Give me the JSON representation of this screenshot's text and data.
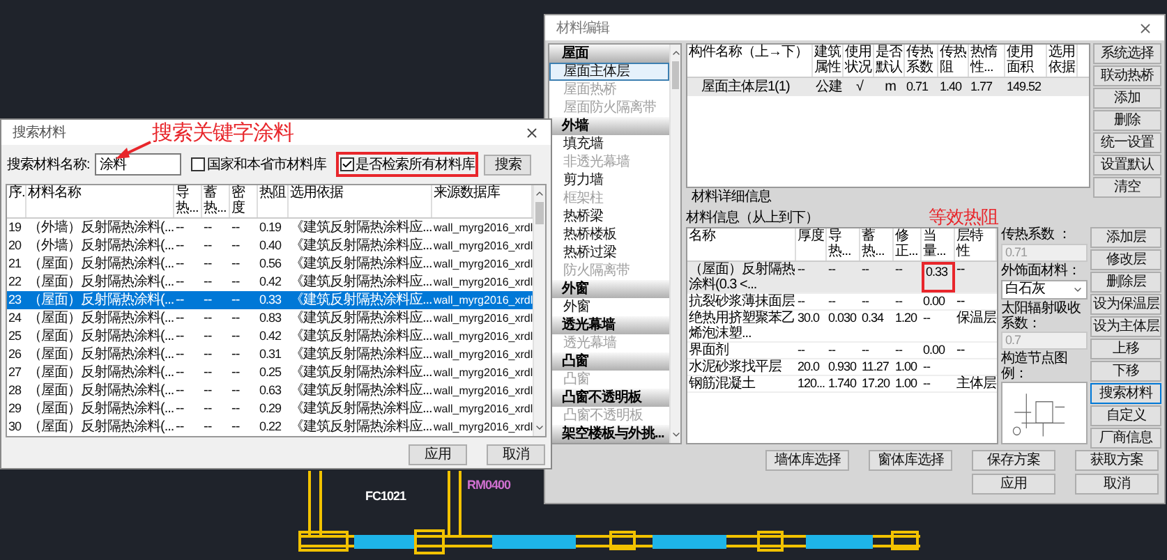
{
  "search_dialog": {
    "title": "搜索材料",
    "annotation": "搜索关键字涂料",
    "search_label": "搜索材料名称:",
    "search_value": "涂料",
    "options": [
      {
        "label": "国家和本省市材料库",
        "checked": false,
        "marked": false
      },
      {
        "label": "是否检索所有材料库",
        "checked": true,
        "marked": true
      }
    ],
    "search_button": "搜索",
    "columns": [
      "序.",
      "材料名称",
      "导热...",
      "蓄热...",
      "密度",
      "热阻",
      "选用依据",
      "来源数据库"
    ],
    "rows": [
      {
        "cells": [
          "19",
          "（外墙）反射隔热涂料(...",
          "--",
          "--",
          "--",
          "0.19",
          "《建筑反射隔热涂料应...",
          "wall_myrg2016_xrdl"
        ],
        "selected": false
      },
      {
        "cells": [
          "20",
          "（外墙）反射隔热涂料(...",
          "--",
          "--",
          "--",
          "0.40",
          "《建筑反射隔热涂料应...",
          "wall_myrg2016_xrdl"
        ],
        "selected": false
      },
      {
        "cells": [
          "21",
          "（屋面）反射隔热涂料(...",
          "--",
          "--",
          "--",
          "0.56",
          "《建筑反射隔热涂料应...",
          "wall_myrg2016_xrdl"
        ],
        "selected": false
      },
      {
        "cells": [
          "22",
          "（屋面）反射隔热涂料(...",
          "--",
          "--",
          "--",
          "0.42",
          "《建筑反射隔热涂料应...",
          "wall_myrg2016_xrdl"
        ],
        "selected": false
      },
      {
        "cells": [
          "23",
          "（屋面）反射隔热涂料(...",
          "--",
          "--",
          "--",
          "0.33",
          "《建筑反射隔热涂料应...",
          "wall_myrg2016_xrdl"
        ],
        "selected": true
      },
      {
        "cells": [
          "24",
          "（屋面）反射隔热涂料(...",
          "--",
          "--",
          "--",
          "0.83",
          "《建筑反射隔热涂料应...",
          "wall_myrg2016_xrdl"
        ],
        "selected": false
      },
      {
        "cells": [
          "25",
          "（屋面）反射隔热涂料(...",
          "--",
          "--",
          "--",
          "0.42",
          "《建筑反射隔热涂料应...",
          "wall_myrg2016_xrdl"
        ],
        "selected": false
      },
      {
        "cells": [
          "26",
          "（屋面）反射隔热涂料(...",
          "--",
          "--",
          "--",
          "0.31",
          "《建筑反射隔热涂料应...",
          "wall_myrg2016_xrdl"
        ],
        "selected": false
      },
      {
        "cells": [
          "27",
          "（屋面）反射隔热涂料(...",
          "--",
          "--",
          "--",
          "0.25",
          "《建筑反射隔热涂料应...",
          "wall_myrg2016_xrdl"
        ],
        "selected": false
      },
      {
        "cells": [
          "28",
          "（屋面）反射隔热涂料(...",
          "--",
          "--",
          "--",
          "0.63",
          "《建筑反射隔热涂料应...",
          "wall_myrg2016_xrdl"
        ],
        "selected": false
      },
      {
        "cells": [
          "29",
          "（屋面）反射隔热涂料(...",
          "--",
          "--",
          "--",
          "0.29",
          "《建筑反射隔热涂料应...",
          "wall_myrg2016_xrdl"
        ],
        "selected": false
      },
      {
        "cells": [
          "30",
          "（屋面）反射隔热涂料(...",
          "--",
          "--",
          "--",
          "0.22",
          "《建筑反射隔热涂料应...",
          "wall_myrg2016_xrdl"
        ],
        "selected": false
      }
    ],
    "buttons": [
      "应用",
      "取消"
    ]
  },
  "editor_dialog": {
    "title": "材料编辑",
    "sidebar": [
      {
        "title": "屋面",
        "items": [
          {
            "label": "屋面主体层",
            "selected": true,
            "disabled": false
          },
          {
            "label": "屋面热桥",
            "selected": false,
            "disabled": true
          },
          {
            "label": "屋面防火隔离带",
            "selected": false,
            "disabled": true
          }
        ]
      },
      {
        "title": "外墙",
        "items": [
          {
            "label": "填充墙",
            "selected": false,
            "disabled": false
          },
          {
            "label": "非透光幕墙",
            "selected": false,
            "disabled": true
          },
          {
            "label": "剪力墙",
            "selected": false,
            "disabled": false
          },
          {
            "label": "框架柱",
            "selected": false,
            "disabled": true
          },
          {
            "label": "热桥梁",
            "selected": false,
            "disabled": false
          },
          {
            "label": "热桥楼板",
            "selected": false,
            "disabled": false
          },
          {
            "label": "热桥过梁",
            "selected": false,
            "disabled": false
          },
          {
            "label": "防火隔离带",
            "selected": false,
            "disabled": true
          }
        ]
      },
      {
        "title": "外窗",
        "items": [
          {
            "label": "外窗",
            "selected": false,
            "disabled": false
          }
        ]
      },
      {
        "title": "透光幕墙",
        "items": [
          {
            "label": "透光幕墙",
            "selected": false,
            "disabled": true
          }
        ]
      },
      {
        "title": "凸窗",
        "items": [
          {
            "label": "凸窗",
            "selected": false,
            "disabled": true
          }
        ]
      },
      {
        "title": "凸窗不透明板",
        "items": [
          {
            "label": "凸窗不透明板",
            "selected": false,
            "disabled": true
          }
        ]
      },
      {
        "title": "架空楼板与外挑..."
      }
    ],
    "layers_table": {
      "columns": [
        "构件名称（上→下）",
        "建筑属性",
        "使用状况",
        "是否默认",
        "传热系数",
        "传热阻",
        "热惰性...",
        "使用面积",
        "选用依据"
      ],
      "rows": [
        {
          "cells": [
            "屋面主体层1(1)",
            "公建",
            "√",
            "m",
            "0.71",
            "1.40",
            "1.77",
            "149.52"
          ],
          "selected": true
        }
      ]
    },
    "side_buttons": [
      "系统选择",
      "联动热桥",
      "添加",
      "删除",
      "统一设置",
      "设置默认",
      "清空"
    ],
    "details_title": "材料详细信息",
    "material_info_label": "材料信息（从上到下）",
    "annotation": "等效热阻",
    "material_table": {
      "columns": [
        "名称",
        "厚度",
        "导热...",
        "蓄热...",
        "修正...",
        "当量...",
        "层特性"
      ],
      "rows": [
        {
          "cells": [
            "（屋面）反射隔热涂料(0.3 <...",
            "--",
            "--",
            "--",
            "--",
            "0.33",
            "--"
          ],
          "selected": true,
          "marked": true
        },
        {
          "cells": [
            "抗裂砂浆薄抹面层",
            "--",
            "--",
            "--",
            "--",
            "0.00",
            "--"
          ],
          "selected": false,
          "marked": false
        },
        {
          "cells": [
            "绝热用挤塑聚苯乙烯泡沫塑...",
            "30.0",
            "0.030",
            "0.34",
            "1.20",
            "--",
            "保温层"
          ],
          "selected": false,
          "marked": false
        },
        {
          "cells": [
            "界面剂",
            "--",
            "--",
            "--",
            "--",
            "0.00",
            "--"
          ],
          "selected": false,
          "marked": false
        },
        {
          "cells": [
            "水泥砂浆找平层",
            "20.0",
            "0.930",
            "11.27",
            "1.00",
            "--"
          ],
          "selected": false,
          "marked": false
        },
        {
          "cells": [
            "钢筋混凝土",
            "120...",
            "1.740",
            "17.20",
            "1.00",
            "--",
            "主体层"
          ],
          "selected": false,
          "marked": false
        }
      ]
    },
    "properties": {
      "conductivity_label": "传热系数 ：",
      "conductivity_value": "0.71",
      "finish_label": "外饰面材料：",
      "finish_value": "白石灰",
      "absorption_label": "太阳辐射吸收系数：",
      "absorption_value": "0.7",
      "diagram_label": "构造节点图例："
    },
    "layer_buttons": [
      {
        "label": "添加层",
        "focused": false
      },
      {
        "label": "修改层",
        "focused": false
      },
      {
        "label": "删除层",
        "focused": false
      },
      {
        "label": "设为保温层",
        "focused": false
      },
      {
        "label": "设为主体层",
        "focused": false
      },
      {
        "label": "上移",
        "focused": false
      },
      {
        "label": "下移",
        "focused": false
      },
      {
        "label": "搜索材料",
        "focused": true
      },
      {
        "label": "自定义",
        "focused": false
      },
      {
        "label": "厂商信息",
        "focused": false
      }
    ],
    "footer_buttons": [
      "墙体库选择",
      "窗体库选择",
      "保存方案",
      "获取方案"
    ],
    "dialog_buttons": [
      "应用",
      "取消"
    ]
  },
  "cad_labels": [
    {
      "text": "FC1021",
      "color": "#ffffff"
    },
    {
      "text": "RM0400",
      "color": "#d070d0"
    }
  ]
}
